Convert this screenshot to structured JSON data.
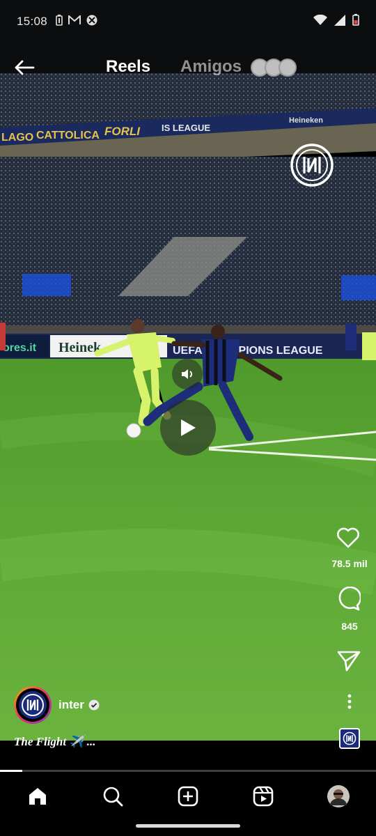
{
  "status": {
    "time": "15:08",
    "icons": [
      "battery-saver-icon",
      "gmail-icon",
      "xbox-icon",
      "wifi-icon",
      "signal-icon",
      "battery-icon"
    ]
  },
  "header": {
    "back_icon": "arrow-left-icon",
    "tab_reels": "Reels",
    "tab_amigos": "Amigos"
  },
  "video": {
    "ad_texts": [
      "LAGO",
      "CATTOLICA",
      "FORLI",
      "IS LEAGUE",
      "Heineken"
    ],
    "board_texts": [
      "ores.it",
      "Heinek",
      "UEFA CHAMPIONS LEAGUE"
    ],
    "playback_progress": 0.06
  },
  "actions": {
    "likes": "78.5 mil",
    "comments": "845"
  },
  "post": {
    "username": "inter",
    "verified": true,
    "caption": "The Flight ✈️ ..."
  },
  "nav": {
    "items": [
      "home-icon",
      "search-icon",
      "create-icon",
      "reels-icon",
      "profile-avatar"
    ]
  },
  "colors": {
    "background": "#000000",
    "inter_blue": "#1b2a7a",
    "pitch_green": "#5fa935"
  }
}
